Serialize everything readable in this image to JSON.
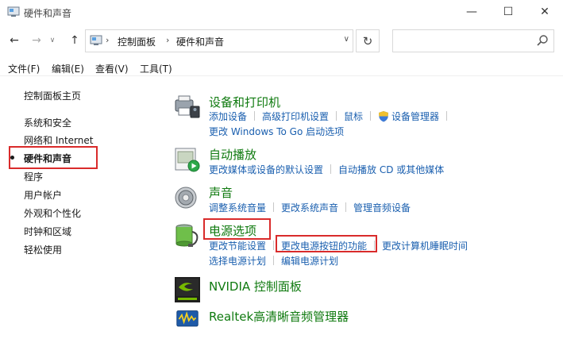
{
  "window": {
    "title": "硬件和声音",
    "min_glyph": "—",
    "max_glyph": "☐",
    "close_glyph": "✕"
  },
  "nav": {
    "back_glyph": "←",
    "forward_glyph": "→",
    "recent_glyph": "∨",
    "up_glyph": "↑",
    "refresh_glyph": "↻",
    "breadcrumb": [
      "控制面板",
      "硬件和声音"
    ],
    "breadcrumb_sep": "›",
    "dropdown_glyph": "∨",
    "search_placeholder": ""
  },
  "menu": [
    "文件(F)",
    "编辑(E)",
    "查看(V)",
    "工具(T)"
  ],
  "sidebar": {
    "items": [
      {
        "label": "控制面板主页"
      },
      {
        "label": "系统和安全"
      },
      {
        "label": "网络和 Internet"
      },
      {
        "label": "硬件和声音",
        "current": true
      },
      {
        "label": "程序"
      },
      {
        "label": "用户帐户"
      },
      {
        "label": "外观和个性化"
      },
      {
        "label": "时钟和区域"
      },
      {
        "label": "轻松使用"
      }
    ]
  },
  "categories": {
    "devices": {
      "title": "设备和打印机",
      "links_row1": [
        "添加设备",
        "高级打印机设置",
        "鼠标",
        "设备管理器"
      ],
      "links_row2": [
        "更改 Windows To Go 启动选项"
      ]
    },
    "autoplay": {
      "title": "自动播放",
      "links_row1": [
        "更改媒体或设备的默认设置",
        "自动播放 CD 或其他媒体"
      ]
    },
    "sound": {
      "title": "声音",
      "links_row1": [
        "调整系统音量",
        "更改系统声音",
        "管理音频设备"
      ]
    },
    "power": {
      "title": "电源选项",
      "links_row1": [
        "更改节能设置",
        "更改电源按钮的功能",
        "更改计算机睡眠时间"
      ],
      "links_row2": [
        "选择电源计划",
        "编辑电源计划"
      ]
    },
    "nvidia": {
      "title": "NVIDIA 控制面板"
    },
    "realtek": {
      "title": "Realtek高清晰音频管理器"
    }
  },
  "colors": {
    "accent_red": "#d92b2b",
    "category_green": "#0f7a0f",
    "link_blue": "#1a5faf"
  }
}
